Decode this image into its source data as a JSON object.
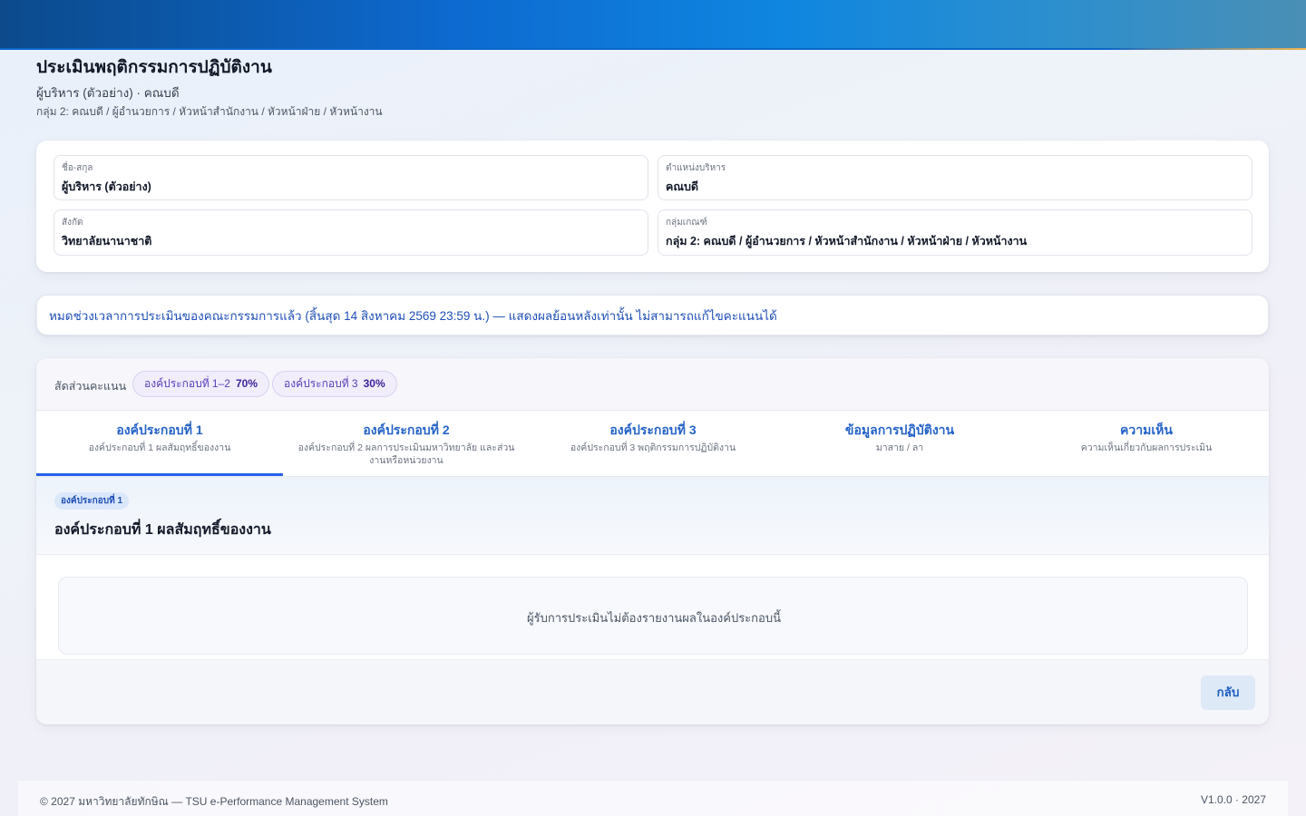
{
  "header": {
    "title": "ประเมินพฤติกรรมการปฏิบัติงาน",
    "subtitle": "ผู้บริหาร (ตัวอย่าง) · คณบดี",
    "group": "กลุ่ม 2: คณบดี / ผู้อำนวยการ / หัวหน้าสำนักงาน / หัวหน้าฝ่าย / หัวหน้างาน"
  },
  "info": {
    "name_label": "ชื่อ-สกุล",
    "name_value": "ผู้บริหาร (ตัวอย่าง)",
    "position_label": "ตำแหน่งบริหาร",
    "position_value": "คณบดี",
    "affiliation_label": "สังกัด",
    "affiliation_value": "วิทยาลัยนานาชาติ",
    "criteria_label": "กลุ่มเกณฑ์",
    "criteria_value": "กลุ่ม 2: คณบดี / ผู้อำนวยการ / หัวหน้าสำนักงาน / หัวหน้าฝ่าย / หัวหน้างาน"
  },
  "notice": "หมดช่วงเวลาการประเมินของคณะกรรมการแล้ว (สิ้นสุด 14 สิงหาคม 2569 23:59 น.) — แสดงผลย้อนหลังเท่านั้น ไม่สามารถแก้ไขคะแนนได้",
  "ratio": {
    "label": "สัดส่วนคะแนน",
    "pills": [
      {
        "label": "องค์ประกอบที่ 1–2",
        "value": "70%"
      },
      {
        "label": "องค์ประกอบที่ 3",
        "value": "30%"
      }
    ]
  },
  "tabs": [
    {
      "title": "องค์ประกอบที่ 1",
      "sub": "องค์ประกอบที่ 1 ผลสัมฤทธิ์ของงาน"
    },
    {
      "title": "องค์ประกอบที่ 2",
      "sub": "องค์ประกอบที่ 2 ผลการประเมินมหาวิทยาลัย และส่วนงานหรือหน่วยงาน"
    },
    {
      "title": "องค์ประกอบที่ 3",
      "sub": "องค์ประกอบที่ 3 พฤติกรรมการปฏิบัติงาน"
    },
    {
      "title": "ข้อมูลการปฏิบัติงาน",
      "sub": "มาสาย / ลา"
    },
    {
      "title": "ความเห็น",
      "sub": "ความเห็นเกี่ยวกับผลการประเมิน"
    }
  ],
  "section": {
    "badge": "องค์ประกอบที่ 1",
    "title": "องค์ประกอบที่ 1 ผลสัมฤทธิ์ของงาน",
    "empty_text": "ผู้รับการประเมินไม่ต้องรายงานผลในองค์ประกอบนี้"
  },
  "actions": {
    "back_label": "กลับ"
  },
  "footer": {
    "copyright": "© 2027 มหาวิทยาลัยทักษิณ — TSU e-Performance Management System",
    "version": "V1.0.0 · 2027"
  },
  "colors": {
    "accent": "#2563eb",
    "topbar": "#0d6ad0",
    "notice_text": "#1f4fb6",
    "pill_text": "#5b3fb8"
  }
}
